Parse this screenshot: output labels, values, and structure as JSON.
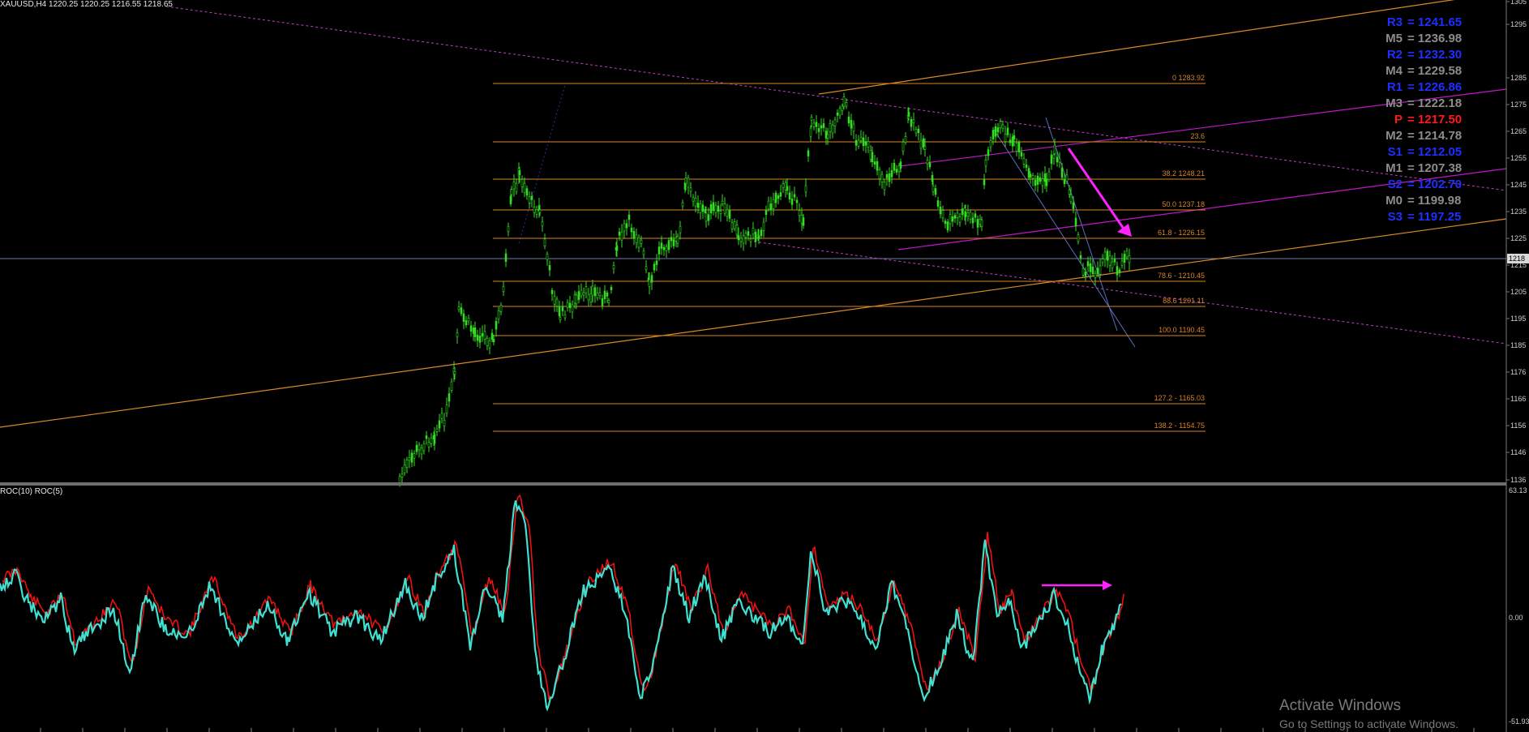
{
  "header": {
    "symbol": "XAUUSD,H4",
    "ohlc": "1220.25 1220.25 1216.55 1218.65"
  },
  "indicator": {
    "title": "ROC(10)  ROC(5)",
    "scale_top": "63.13",
    "scale_zero": "0.00",
    "scale_bottom": "-51.93"
  },
  "price_axis": {
    "labels": [
      "1305",
      "1295",
      "1285",
      "1275",
      "1265",
      "1255",
      "1245",
      "1235",
      "1225",
      "1215",
      "1205",
      "1195",
      "1185",
      "1176",
      "1166",
      "1156",
      "1146",
      "1136"
    ],
    "current_price": "1218"
  },
  "fib_labels": [
    {
      "text": "0 1283.92"
    },
    {
      "text": "23.6"
    },
    {
      "text": "38.2 1248.21"
    },
    {
      "text": "50.0 1237.18"
    },
    {
      "text": "61.8 - 1226.15"
    },
    {
      "text": "78.6 - 1210.45"
    },
    {
      "text": "88.6 1201.11"
    },
    {
      "text": "100.0 1190.45"
    },
    {
      "text": "127.2 - 1165.03"
    },
    {
      "text": "138.2 - 1154.75"
    }
  ],
  "pivots": [
    {
      "label": "R3",
      "value": "= 1241.65",
      "color": "#1f2fff"
    },
    {
      "label": "M5",
      "value": "= 1236.98",
      "color": "#8c8c8c"
    },
    {
      "label": "R2",
      "value": "= 1232.30",
      "color": "#1f2fff"
    },
    {
      "label": "M4",
      "value": "= 1229.58",
      "color": "#8c8c8c"
    },
    {
      "label": "R1",
      "value": "= 1226.86",
      "color": "#1f2fff"
    },
    {
      "label": "M3",
      "value": "= 1222.18",
      "color": "#8c8c8c"
    },
    {
      "label": "P",
      "value": "= 1217.50",
      "color": "#ff1a1a"
    },
    {
      "label": "M2",
      "value": "= 1214.78",
      "color": "#8c8c8c"
    },
    {
      "label": "S1",
      "value": "= 1212.05",
      "color": "#1f2fff"
    },
    {
      "label": "M1",
      "value": "= 1207.38",
      "color": "#8c8c8c"
    },
    {
      "label": "S2",
      "value": "= 1202.70",
      "color": "#1f2fff"
    },
    {
      "label": "M0",
      "value": "= 1199.98",
      "color": "#8c8c8c"
    },
    {
      "label": "S3",
      "value": "= 1197.25",
      "color": "#1f2fff"
    }
  ],
  "watermark": {
    "line1": "Activate Windows",
    "line2": "Go to Settings to activate Windows."
  },
  "colors": {
    "background": "#000000",
    "candles": "#33dd22",
    "fib_lines": "#d98324",
    "trend_orange": "#e0a030",
    "trend_magenta": "#d418d4",
    "arrow": "#ff22ff",
    "roc10": "#ee1111",
    "roc5": "#40e0d0"
  }
}
